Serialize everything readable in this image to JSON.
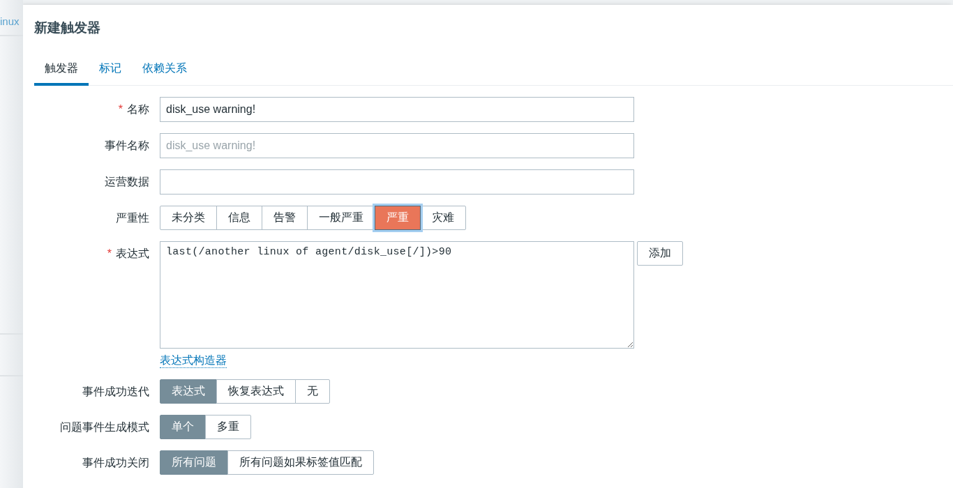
{
  "background": {
    "text": "inux"
  },
  "dialog": {
    "title": "新建触发器",
    "required_mark": "*",
    "tabs": [
      {
        "label": "触发器",
        "selected": true
      },
      {
        "label": "标记",
        "selected": false
      },
      {
        "label": "依赖关系",
        "selected": false
      }
    ],
    "fields": [
      {
        "kind": "text",
        "label": "名称",
        "required": true,
        "value": "disk_use warning!"
      },
      {
        "kind": "text",
        "label": "事件名称",
        "required": false,
        "placeholder": "disk_use warning!"
      },
      {
        "kind": "text",
        "label": "运营数据",
        "required": false
      },
      {
        "kind": "severity",
        "label": "严重性",
        "required": false,
        "options": [
          {
            "label": "未分类",
            "selected": false
          },
          {
            "label": "信息",
            "selected": false
          },
          {
            "label": "告警",
            "selected": false
          },
          {
            "label": "一般严重",
            "selected": false
          },
          {
            "label": "严重",
            "selected": true
          },
          {
            "label": "灾难",
            "selected": false
          }
        ]
      },
      {
        "kind": "textarea",
        "label": "表达式",
        "required": true,
        "value": "last(/another linux of agent/disk_use[/])>90",
        "button": "添加",
        "link": "表达式构造器"
      },
      {
        "kind": "segmented",
        "label": "事件成功迭代",
        "required": false,
        "options": [
          {
            "label": "表达式",
            "selected": true
          },
          {
            "label": "恢复表达式",
            "selected": false
          },
          {
            "label": "无",
            "selected": false
          }
        ]
      },
      {
        "kind": "segmented",
        "label": "问题事件生成模式",
        "required": false,
        "options": [
          {
            "label": "单个",
            "selected": true
          },
          {
            "label": "多重",
            "selected": false
          }
        ]
      },
      {
        "kind": "segmented",
        "label": "事件成功关闭",
        "required": false,
        "options": [
          {
            "label": "所有问题",
            "selected": true
          },
          {
            "label": "所有问题如果标签值匹配",
            "selected": false
          }
        ]
      }
    ]
  }
}
